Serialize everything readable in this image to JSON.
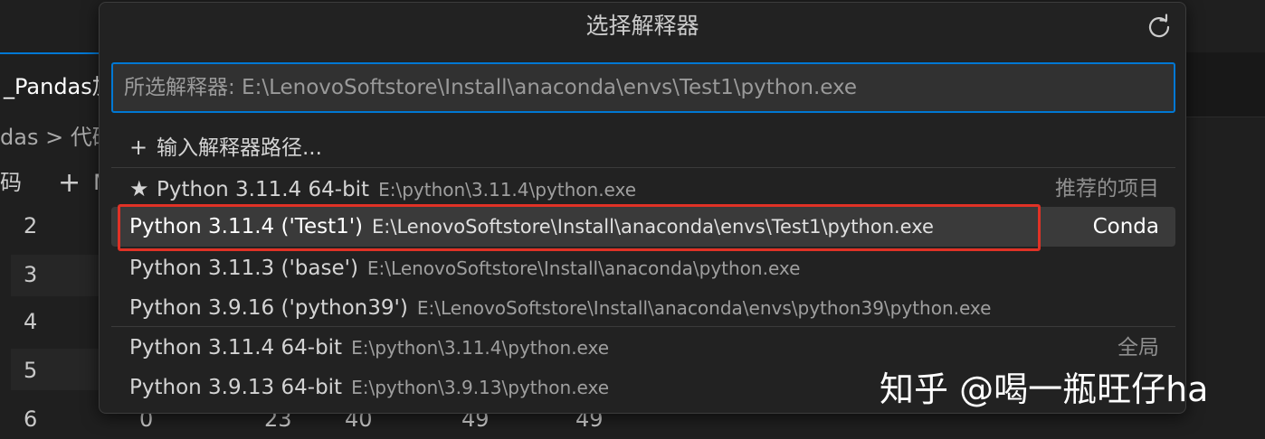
{
  "editor": {
    "tab_label": "_Pandas加",
    "breadcrumb": "das > 代码",
    "toolbar_text": "码",
    "toolbar_add": "M",
    "line_numbers": [
      "2",
      "3",
      "4",
      "5",
      "6"
    ],
    "row6_cells": [
      "0",
      "23",
      "40",
      "49",
      "49"
    ]
  },
  "quick_pick": {
    "title": "选择解释器",
    "refresh_icon": "refresh-icon",
    "input_placeholder": "所选解释器: E:\\LenovoSoftstore\\Install\\anaconda\\envs\\Test1\\python.exe",
    "enter_path_label": "输入解释器路径...",
    "items": [
      {
        "label": "Python 3.11.4 64-bit",
        "path": "E:\\python\\3.11.4\\python.exe",
        "group": "推荐的项目",
        "icon": "star-icon"
      },
      {
        "label": "Python 3.11.4 ('Test1')",
        "path": "E:\\LenovoSoftstore\\Install\\anaconda\\envs\\Test1\\python.exe",
        "group": "Conda",
        "selected": true
      },
      {
        "label": "Python 3.11.3 ('base')",
        "path": "E:\\LenovoSoftstore\\Install\\anaconda\\python.exe"
      },
      {
        "label": "Python 3.9.16 ('python39')",
        "path": "E:\\LenovoSoftstore\\Install\\anaconda\\envs\\python39\\python.exe"
      },
      {
        "label": "Python 3.11.4 64-bit",
        "path": "E:\\python\\3.11.4\\python.exe",
        "group": "全局"
      },
      {
        "label": "Python 3.9.13 64-bit",
        "path": "E:\\python\\3.9.13\\python.exe"
      }
    ]
  },
  "watermark": "知乎 @喝一瓶旺仔ha",
  "colors": {
    "accent": "#0078d4",
    "highlight_box": "#e03226",
    "panel_bg": "#222222"
  }
}
